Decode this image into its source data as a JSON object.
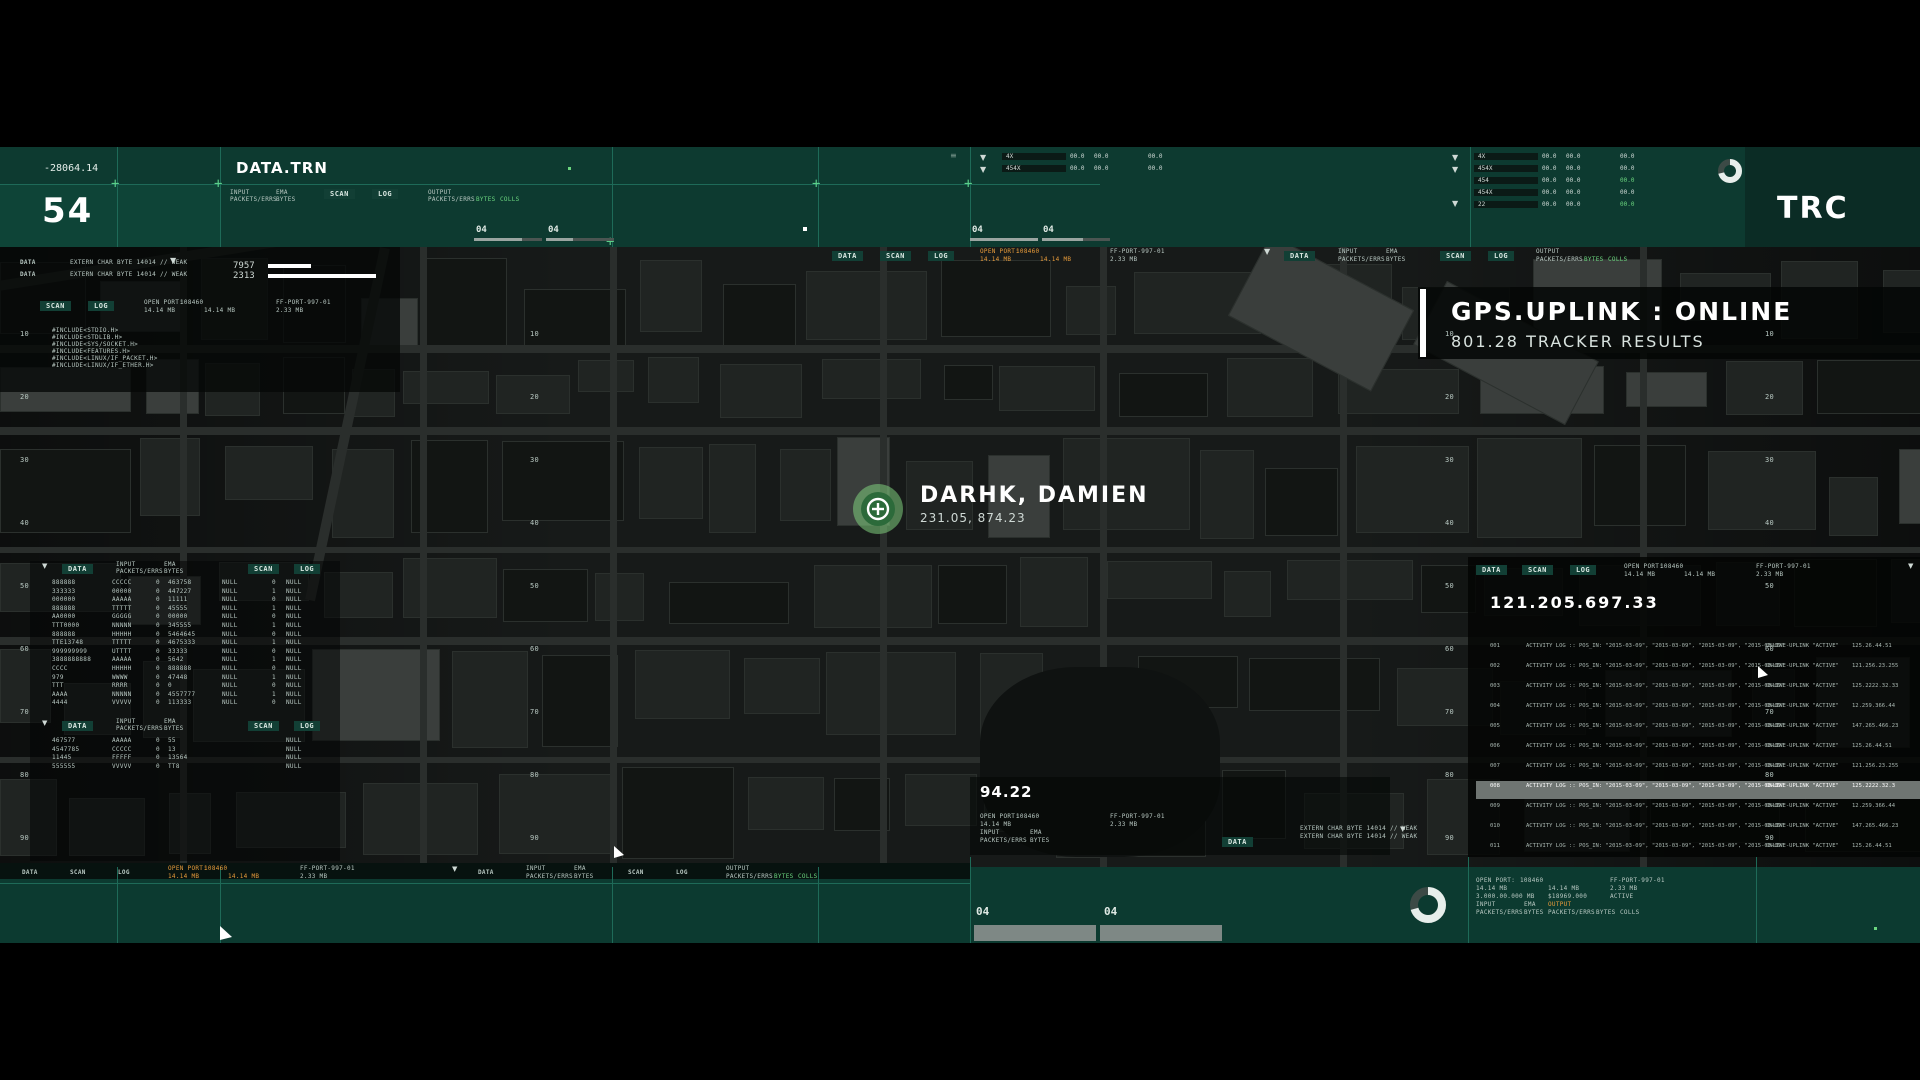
{
  "top_left": {
    "coord": "-28064.14",
    "counter": "54"
  },
  "data_panel": {
    "title": "DATA.TRN",
    "labels": {
      "input": "INPUT",
      "packets": "PACKETS/ERRS",
      "ema": "EMA",
      "bytes": "BYTES",
      "output": "OUTPUT",
      "packets2": "PACKETS/ERRS",
      "bytes2": "BYTES",
      "colls": "COLLS"
    },
    "tabs": [
      "SCAN",
      "LOG"
    ],
    "progress_labels": [
      "04",
      "04"
    ],
    "progress": [
      0.7,
      0.4
    ]
  },
  "top_right": {
    "code": "TRC"
  },
  "top_center": {
    "rows": [
      {
        "name": "4X",
        "a": "00.0",
        "b": "00.0",
        "c": "00.0"
      },
      {
        "name": "454X",
        "a": "00.0",
        "b": "00.0",
        "c": "00.0"
      }
    ],
    "progress_labels": [
      "04",
      "04"
    ]
  },
  "top_right_table": {
    "rows": [
      {
        "name": "4X",
        "a": "00.0",
        "b": "00.0",
        "c": "00.0"
      },
      {
        "name": "454X",
        "a": "00.0",
        "b": "00.0",
        "c": "00.0"
      },
      {
        "name": "454",
        "a": "00.0",
        "b": "00.0",
        "c": "00.0"
      },
      {
        "name": "454X",
        "a": "00.0",
        "b": "00.0",
        "c": "00.0"
      },
      {
        "name": "22",
        "a": "00.0",
        "b": "00.0",
        "c": "00.0"
      }
    ]
  },
  "left_stats": {
    "rows": [
      {
        "label": "DATA",
        "text": "EXTERN CHAR BYTE 14014 // WEAK"
      },
      {
        "label": "DATA",
        "text": "EXTERN CHAR BYTE 14014 // WEAK"
      }
    ],
    "bars": [
      {
        "value": "7957",
        "level": 0.4
      },
      {
        "value": "2313",
        "level": 1.0
      }
    ],
    "tabs": [
      "SCAN",
      "LOG"
    ],
    "open_port": "OPEN PORT:",
    "port_val": "108460",
    "port_size": "14.14 MB",
    "port_size2": "14.14 MB",
    "ff_port": "FF-PORT-997-01",
    "ff_size": "2.33 MB",
    "includes": [
      "#INCLUDE<STDIO.H>",
      "#INCLUDE<STDLIB.H>",
      "#INCLUDE<SYS/SOCKET.H>",
      "#INCLUDE<FEATURES.H>",
      "#INCLUDE<LINUX/IF_PACKET.H>",
      "#INCLUDE<LINUX/IF_ETHER.H>"
    ]
  },
  "strip_tabs": {
    "a": [
      "DATA",
      "SCAN",
      "LOG"
    ],
    "b": [
      "DATA",
      "SCAN",
      "LOG"
    ]
  },
  "target": {
    "name": "DARHK, DAMIEN",
    "coords": "231.05, 874.23"
  },
  "gps": {
    "status": "GPS.UPLINK : ONLINE",
    "results": "801.28 TRACKER RESULTS"
  },
  "ip_panel": {
    "ip": "121.205.697.33",
    "tabs": [
      "DATA",
      "SCAN",
      "LOG"
    ],
    "log": [
      {
        "id": "001",
        "text": "ACTIVITY LOG :: POS_IN: \"2015-03-09\", \"2015-03-09\", \"2015-03-09\", \"2015-03-09\"",
        "status": "ONLINE-UPLINK \"ACTIVE\"",
        "ip": "125.26.44.51"
      },
      {
        "id": "002",
        "text": "ACTIVITY LOG :: POS_IN: \"2015-03-09\", \"2015-03-09\", \"2015-03-09\", \"2015-03-09\"",
        "status": "ONLINE-UPLINK \"ACTIVE\"",
        "ip": "121.256.23.255"
      },
      {
        "id": "003",
        "text": "ACTIVITY LOG :: POS_IN: \"2015-03-09\", \"2015-03-09\", \"2015-03-09\", \"2015-03-09\"",
        "status": "ONLINE-UPLINK \"ACTIVE\"",
        "ip": "125.2222.32.33"
      },
      {
        "id": "004",
        "text": "ACTIVITY LOG :: POS_IN: \"2015-03-09\", \"2015-03-09\", \"2015-03-09\", \"2015-03-09\"",
        "status": "ONLINE-UPLINK \"ACTIVE\"",
        "ip": "12.259.366.44"
      },
      {
        "id": "005",
        "text": "ACTIVITY LOG :: POS_IN: \"2015-03-09\", \"2015-03-09\", \"2015-03-09\", \"2015-03-09\"",
        "status": "ONLINE-UPLINK \"ACTIVE\"",
        "ip": "147.265.466.23"
      },
      {
        "id": "006",
        "text": "ACTIVITY LOG :: POS_IN: \"2015-03-09\", \"2015-03-09\", \"2015-03-09\", \"2015-03-09\"",
        "status": "ONLINE-UPLINK \"ACTIVE\"",
        "ip": "125.26.44.51"
      },
      {
        "id": "007",
        "text": "ACTIVITY LOG :: POS_IN: \"2015-03-09\", \"2015-03-09\", \"2015-03-09\", \"2015-03-09\"",
        "status": "ONLINE-UPLINK \"ACTIVE\"",
        "ip": "121.256.23.255"
      },
      {
        "id": "008",
        "text": "ACTIVITY LOG :: POS_IN: \"2015-03-09\", \"2015-03-09\", \"2015-03-09\", \"2015-03-09\"",
        "status": "ONLINE-UPLINK \"ACTIVE\"",
        "ip": "125.2222.32.3"
      },
      {
        "id": "009",
        "text": "ACTIVITY LOG :: POS_IN: \"2015-03-09\", \"2015-03-09\", \"2015-03-09\", \"2015-03-09\"",
        "status": "ONLINE-UPLINK \"ACTIVE\"",
        "ip": "12.259.366.44"
      },
      {
        "id": "010",
        "text": "ACTIVITY LOG :: POS_IN: \"2015-03-09\", \"2015-03-09\", \"2015-03-09\", \"2015-03-09\"",
        "status": "ONLINE-UPLINK \"ACTIVE\"",
        "ip": "147.265.466.23"
      },
      {
        "id": "011",
        "text": "ACTIVITY LOG :: POS_IN: \"2015-03-09\", \"2015-03-09\", \"2015-03-09\", \"2015-03-09\"",
        "status": "ONLINE-UPLINK \"ACTIVE\"",
        "ip": "125.26.44.51"
      }
    ],
    "selected_index": 7
  },
  "mid_bottom": {
    "value": "94.22",
    "open_port": "OPEN PORT:",
    "port_val": "108460",
    "ff_port": "FF-PORT-997-01",
    "size": "14.14 MB",
    "size2": "2.33 MB",
    "tab": "DATA"
  },
  "bottom_center": {
    "labels": [
      "04",
      "04"
    ]
  },
  "bottom_right": {
    "open_port": "OPEN PORT:",
    "port_val": "108460",
    "ff_port": "FF-PORT-997-01",
    "size": "14.14 MB",
    "size2": "2.33 MB",
    "size3": "3.000.00.000 MB",
    "size4": "$18969.000",
    "input": "INPUT",
    "ema": "EMA",
    "output": "OUTPUT",
    "active": "ACTIVE",
    "packets": "PACKETS/ERRS",
    "bytes": "BYTES",
    "colls": "COLLS"
  },
  "left_table": {
    "header": [
      "DATA",
      "INPUT",
      "EMA"
    ],
    "sub": [
      "PACKETS/ERRS",
      "BYTES"
    ],
    "tabs": [
      "SCAN",
      "LOG"
    ],
    "col1": [
      "888888",
      "333333",
      "000000",
      "888888",
      "AA0000",
      "TTT0000",
      "888888",
      "TTE13748",
      "999999999",
      "3888888888",
      "CCCC",
      "979",
      "TTT",
      "AAAA",
      "4444"
    ],
    "col2": [
      "CCCCC",
      "00000",
      "AAAAA",
      "TTTTT",
      "GGGGG",
      "NNNNN",
      "HHHHH",
      "TTTTT",
      "UTTTT",
      "AAAAA",
      "HHHHH",
      "WWWW",
      "RRRR",
      "NNNNN",
      "VVVVV"
    ],
    "col3": [
      "0",
      "0",
      "0",
      "0",
      "0",
      "0",
      "0",
      "0",
      "0",
      "0",
      "0",
      "0",
      "0",
      "0",
      "0"
    ],
    "col4": [
      "463758",
      "447227",
      "11111",
      "45555",
      "00000",
      "345555",
      "5464645",
      "4675333",
      "33333",
      "5642",
      "888888",
      "47448",
      "0",
      "4557777",
      "113333"
    ],
    "col5": [
      "NULL",
      "NULL",
      "NULL",
      "NULL",
      "NULL",
      "NULL",
      "NULL",
      "NULL",
      "NULL",
      "NULL",
      "NULL",
      "NULL",
      "NULL",
      "NULL",
      "NULL"
    ],
    "col6": [
      "0",
      "1",
      "0",
      "1",
      "0",
      "1",
      "0",
      "1",
      "0",
      "1",
      "0",
      "1",
      "0",
      "1",
      "0"
    ],
    "col7": [
      "NULL",
      "NULL",
      "NULL",
      "NULL",
      "NULL",
      "NULL",
      "NULL",
      "NULL",
      "NULL",
      "NULL",
      "NULL",
      "NULL",
      "NULL",
      "NULL",
      "NULL"
    ]
  },
  "left_table2": {
    "header": [
      "DATA",
      "INPUT",
      "EMA"
    ],
    "sub": [
      "PACKETS/ERRS",
      "BYTES"
    ],
    "tabs": [
      "SCAN",
      "LOG"
    ],
    "col1": [
      "467577",
      "4547785",
      "11445",
      "555555"
    ],
    "col2": [
      "AAAAA",
      "CCCCC",
      "FFFFF",
      "VVVVV"
    ],
    "col3": [
      "0",
      "0",
      "0",
      "0"
    ],
    "col4": [
      "55",
      "13",
      "13564",
      "TT8"
    ],
    "col5": [
      "NULL",
      "NULL",
      "NULL",
      "NULL"
    ]
  },
  "scale_left": [
    "10",
    "20",
    "30",
    "40",
    "50",
    "60",
    "70",
    "80",
    "90"
  ],
  "colors": {
    "teal": "#0d3a30",
    "accent": "#6bd67f",
    "orange": "#e69a3a"
  }
}
